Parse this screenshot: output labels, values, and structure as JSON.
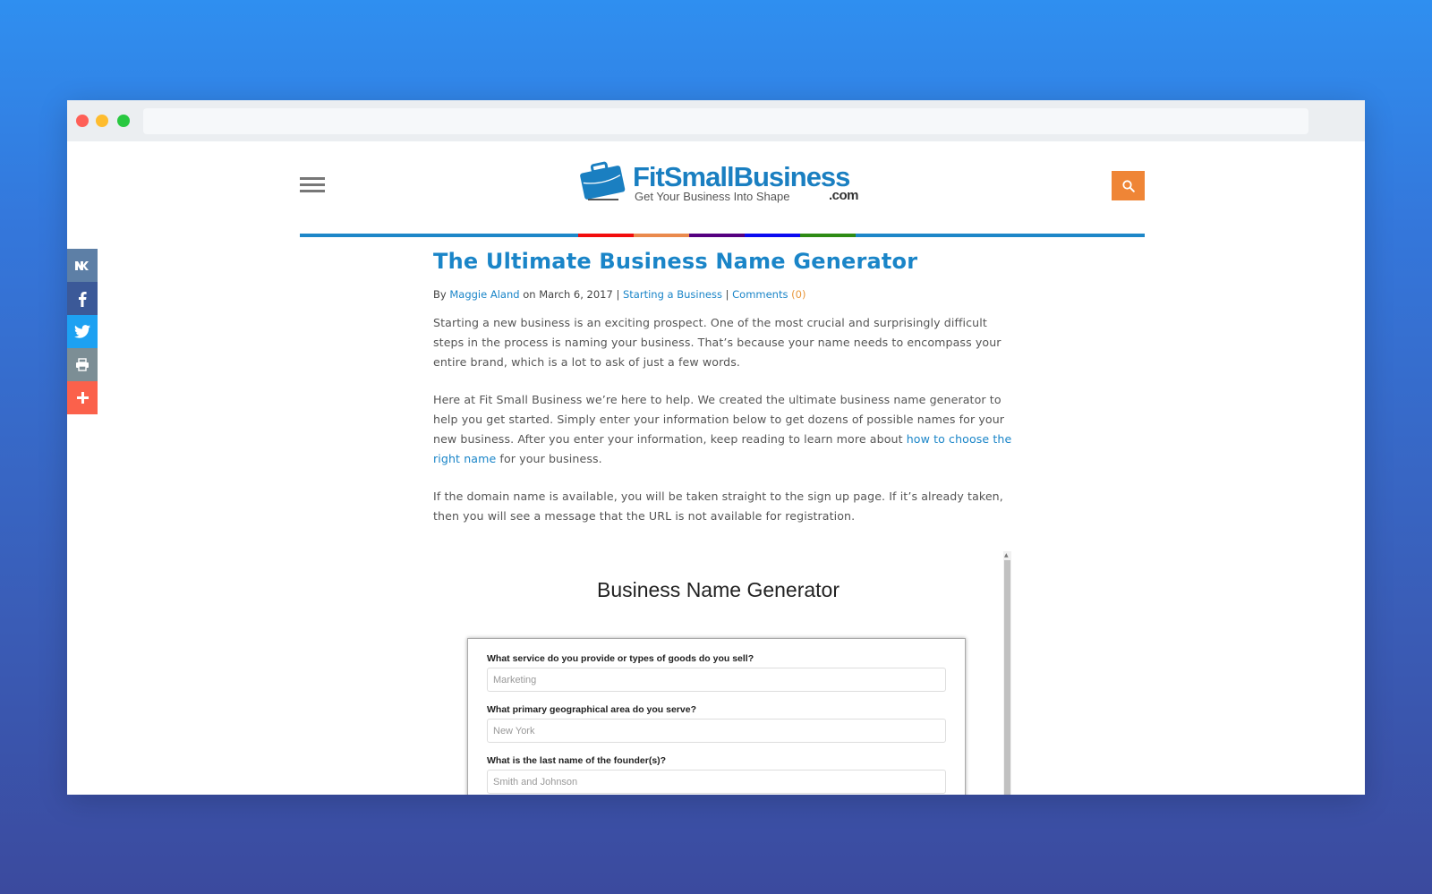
{
  "browser": {
    "address": ""
  },
  "header": {
    "brand": "FitSmallBusiness",
    "tagline": "Get Your Business Into Shape",
    "tld": ".com",
    "menu_icon": "hamburger-icon",
    "search_icon": "search-icon",
    "accent_color": "#ef8536",
    "colorbar": [
      "#1e87c8",
      "#f20c0c",
      "#ea8a4d",
      "#550080",
      "#0b0bf0",
      "#2e8b14",
      "#1e87c8"
    ]
  },
  "social": [
    {
      "name": "vk",
      "icon": "vk-icon",
      "color": "#5d7fa6"
    },
    {
      "name": "facebook",
      "icon": "facebook-icon",
      "color": "#3b5998"
    },
    {
      "name": "twitter",
      "icon": "twitter-icon",
      "color": "#1da1f2"
    },
    {
      "name": "print",
      "icon": "print-icon",
      "color": "#7c8e95"
    },
    {
      "name": "more",
      "icon": "plus-icon",
      "color": "#fb614b"
    }
  ],
  "article": {
    "title": "The Ultimate Business Name Generator",
    "meta": {
      "by": "By ",
      "author": "Maggie Aland",
      "on": " on March 6, 2017 | ",
      "category": "Starting a Business",
      "sep": " | ",
      "comments_label": "Comments",
      "comments_count": " (0)"
    },
    "paragraphs": {
      "p1": "Starting a new business is an exciting prospect. One of the most crucial and surprisingly difficult steps in the process is naming your business. That’s because your name needs to encompass your entire brand, which is a lot to ask of just a few words.",
      "p2_before": "Here at Fit Small Business we’re here to help. We created the ultimate business name generator to help you get started. Simply enter your information below to get dozens of possible names for your new business. After you enter your information, keep reading to learn more about ",
      "p2_link": "how to choose the right name",
      "p2_after": " for your business.",
      "p3": "If the domain name is available, you will be taken straight to the sign up page. If it’s already taken, then you will see a message that the URL is not available for registration."
    }
  },
  "generator": {
    "title": "Business Name Generator",
    "fields": [
      {
        "label": "What service do you provide or types of goods do you sell?",
        "placeholder": "Marketing",
        "value": ""
      },
      {
        "label": "What primary geographical area do you serve?",
        "placeholder": "New York",
        "value": ""
      },
      {
        "label": "What is the last name of the founder(s)?",
        "placeholder": "Smith and Johnson",
        "value": ""
      }
    ]
  }
}
